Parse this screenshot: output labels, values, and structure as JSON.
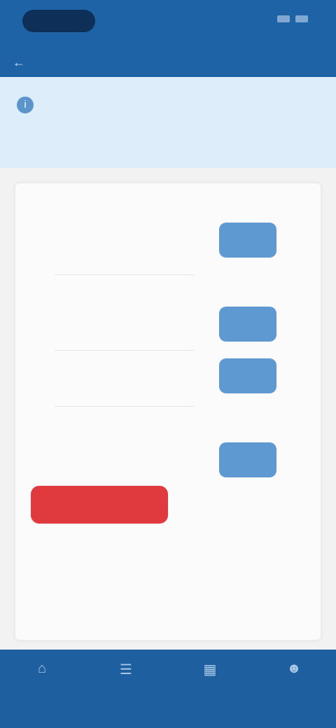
{
  "status_bar": {
    "time_pill": ""
  },
  "app_bar": {
    "back_icon": "arrow-left-icon",
    "title": ""
  },
  "notice": {
    "icon": "info-icon",
    "text": "",
    "link": ""
  },
  "rows": [
    {
      "label": "",
      "button": ""
    },
    {
      "label": "",
      "button": ""
    },
    {
      "label": "",
      "button": ""
    },
    {
      "label": "",
      "button": ""
    }
  ],
  "red_button": {
    "label": ""
  },
  "small_note": "",
  "footer_link": "",
  "nav": [
    {
      "icon": "home-icon",
      "label": ""
    },
    {
      "icon": "list-icon",
      "label": ""
    },
    {
      "icon": "grid-icon",
      "label": ""
    },
    {
      "icon": "user-icon",
      "label": ""
    }
  ],
  "colors": {
    "primary_blue": "#1d63a6",
    "button_blue": "#5e9ad1",
    "danger_red": "#e03a3f",
    "notice_bg": "#ddeefa"
  }
}
